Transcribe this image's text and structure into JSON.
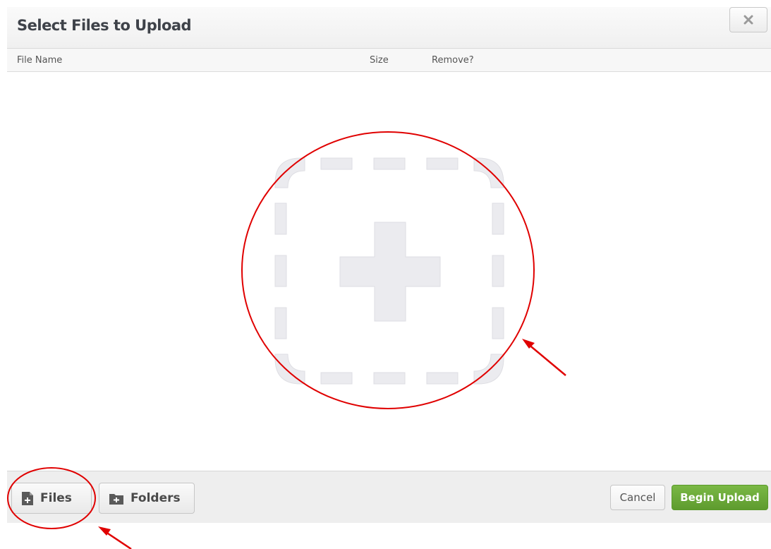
{
  "dialog": {
    "title": "Select Files to Upload",
    "close_icon": "close-icon"
  },
  "table_header": {
    "file_name": "File Name",
    "size": "Size",
    "remove": "Remove?"
  },
  "drop_zone": {
    "icon": "plus-icon"
  },
  "footer": {
    "files_label": "Files",
    "files_icon": "add-file-icon",
    "folders_label": "Folders",
    "folders_icon": "add-folder-icon",
    "cancel_label": "Cancel",
    "begin_upload_label": "Begin Upload"
  },
  "colors": {
    "accent_green": "#5e9b2e",
    "annotation_red": "#e00000",
    "drop_zone_fill": "#ebebef"
  }
}
